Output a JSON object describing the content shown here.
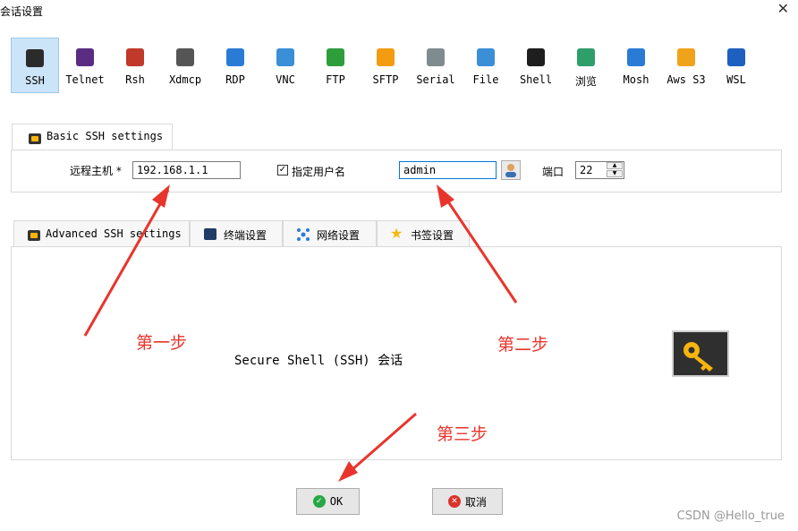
{
  "window": {
    "title": "会话设置"
  },
  "toolbar": {
    "items": [
      {
        "label": "SSH",
        "color": "#2b2b2b",
        "selected": true
      },
      {
        "label": "Telnet",
        "color": "#5a2d82"
      },
      {
        "label": "Rsh",
        "color": "#c0392b"
      },
      {
        "label": "Xdmcp",
        "color": "#555555"
      },
      {
        "label": "RDP",
        "color": "#2a7bd6"
      },
      {
        "label": "VNC",
        "color": "#3a8fd6"
      },
      {
        "label": "FTP",
        "color": "#2e9e3a"
      },
      {
        "label": "SFTP",
        "color": "#f39c12"
      },
      {
        "label": "Serial",
        "color": "#7f8c8d"
      },
      {
        "label": "File",
        "color": "#3a8fd6"
      },
      {
        "label": "Shell",
        "color": "#1e1e1e"
      },
      {
        "label": "浏览",
        "color": "#2e9e6a"
      },
      {
        "label": "Mosh",
        "color": "#2a7bd6"
      },
      {
        "label": "Aws S3",
        "color": "#f1a21b"
      },
      {
        "label": "WSL",
        "color": "#1f5fbf"
      }
    ]
  },
  "basic": {
    "tab_label": "Basic SSH settings",
    "host_label": "远程主机 *",
    "host_value": "192.168.1.1",
    "user_checkbox_label": "指定用户名",
    "user_checkbox_mark": "✓",
    "user_value": "admin",
    "port_label": "端口",
    "port_value": "22"
  },
  "advanced_tabs": [
    {
      "label": "Advanced SSH settings"
    },
    {
      "label": "终端设置"
    },
    {
      "label": "网络设置"
    },
    {
      "label": "书签设置"
    }
  ],
  "panel": {
    "description": "Secure Shell (SSH) 会话"
  },
  "annotations": {
    "step1": "第一步",
    "step2": "第二步",
    "step3": "第三步"
  },
  "buttons": {
    "ok": "OK",
    "cancel": "取消"
  },
  "watermark": "CSDN @Hello_true"
}
